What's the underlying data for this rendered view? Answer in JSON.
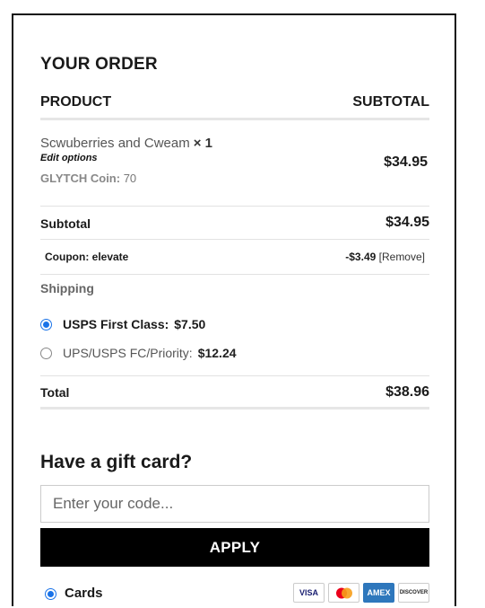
{
  "order": {
    "title": "YOUR ORDER",
    "col_product": "PRODUCT",
    "col_subtotal": "SUBTOTAL",
    "item": {
      "name": "Scwuberries and Cweam",
      "qty": "× 1",
      "edit_label": "Edit options",
      "coin_label": "GLYTCH Coin:",
      "coin_value": "70",
      "price": "$34.95"
    },
    "subtotal_label": "Subtotal",
    "subtotal_value": "$34.95",
    "coupon_label": "Coupon: elevate",
    "coupon_value": "-$3.49",
    "coupon_remove": "[Remove]",
    "shipping_label": "Shipping",
    "shipping_options": [
      {
        "label": "USPS First Class:",
        "price": "$7.50",
        "selected": true
      },
      {
        "label": "UPS/USPS FC/Priority:",
        "price": "$12.24",
        "selected": false
      }
    ],
    "total_label": "Total",
    "total_value": "$38.96"
  },
  "gift": {
    "title": "Have a gift card?",
    "placeholder": "Enter your code...",
    "apply_label": "APPLY"
  },
  "payment": {
    "cards_label": "Cards",
    "icons": [
      "VISA",
      "mastercard",
      "AMEX",
      "DISCOVER"
    ]
  },
  "colors": {
    "accent": "#1a73e8",
    "button_bg": "#000000"
  }
}
